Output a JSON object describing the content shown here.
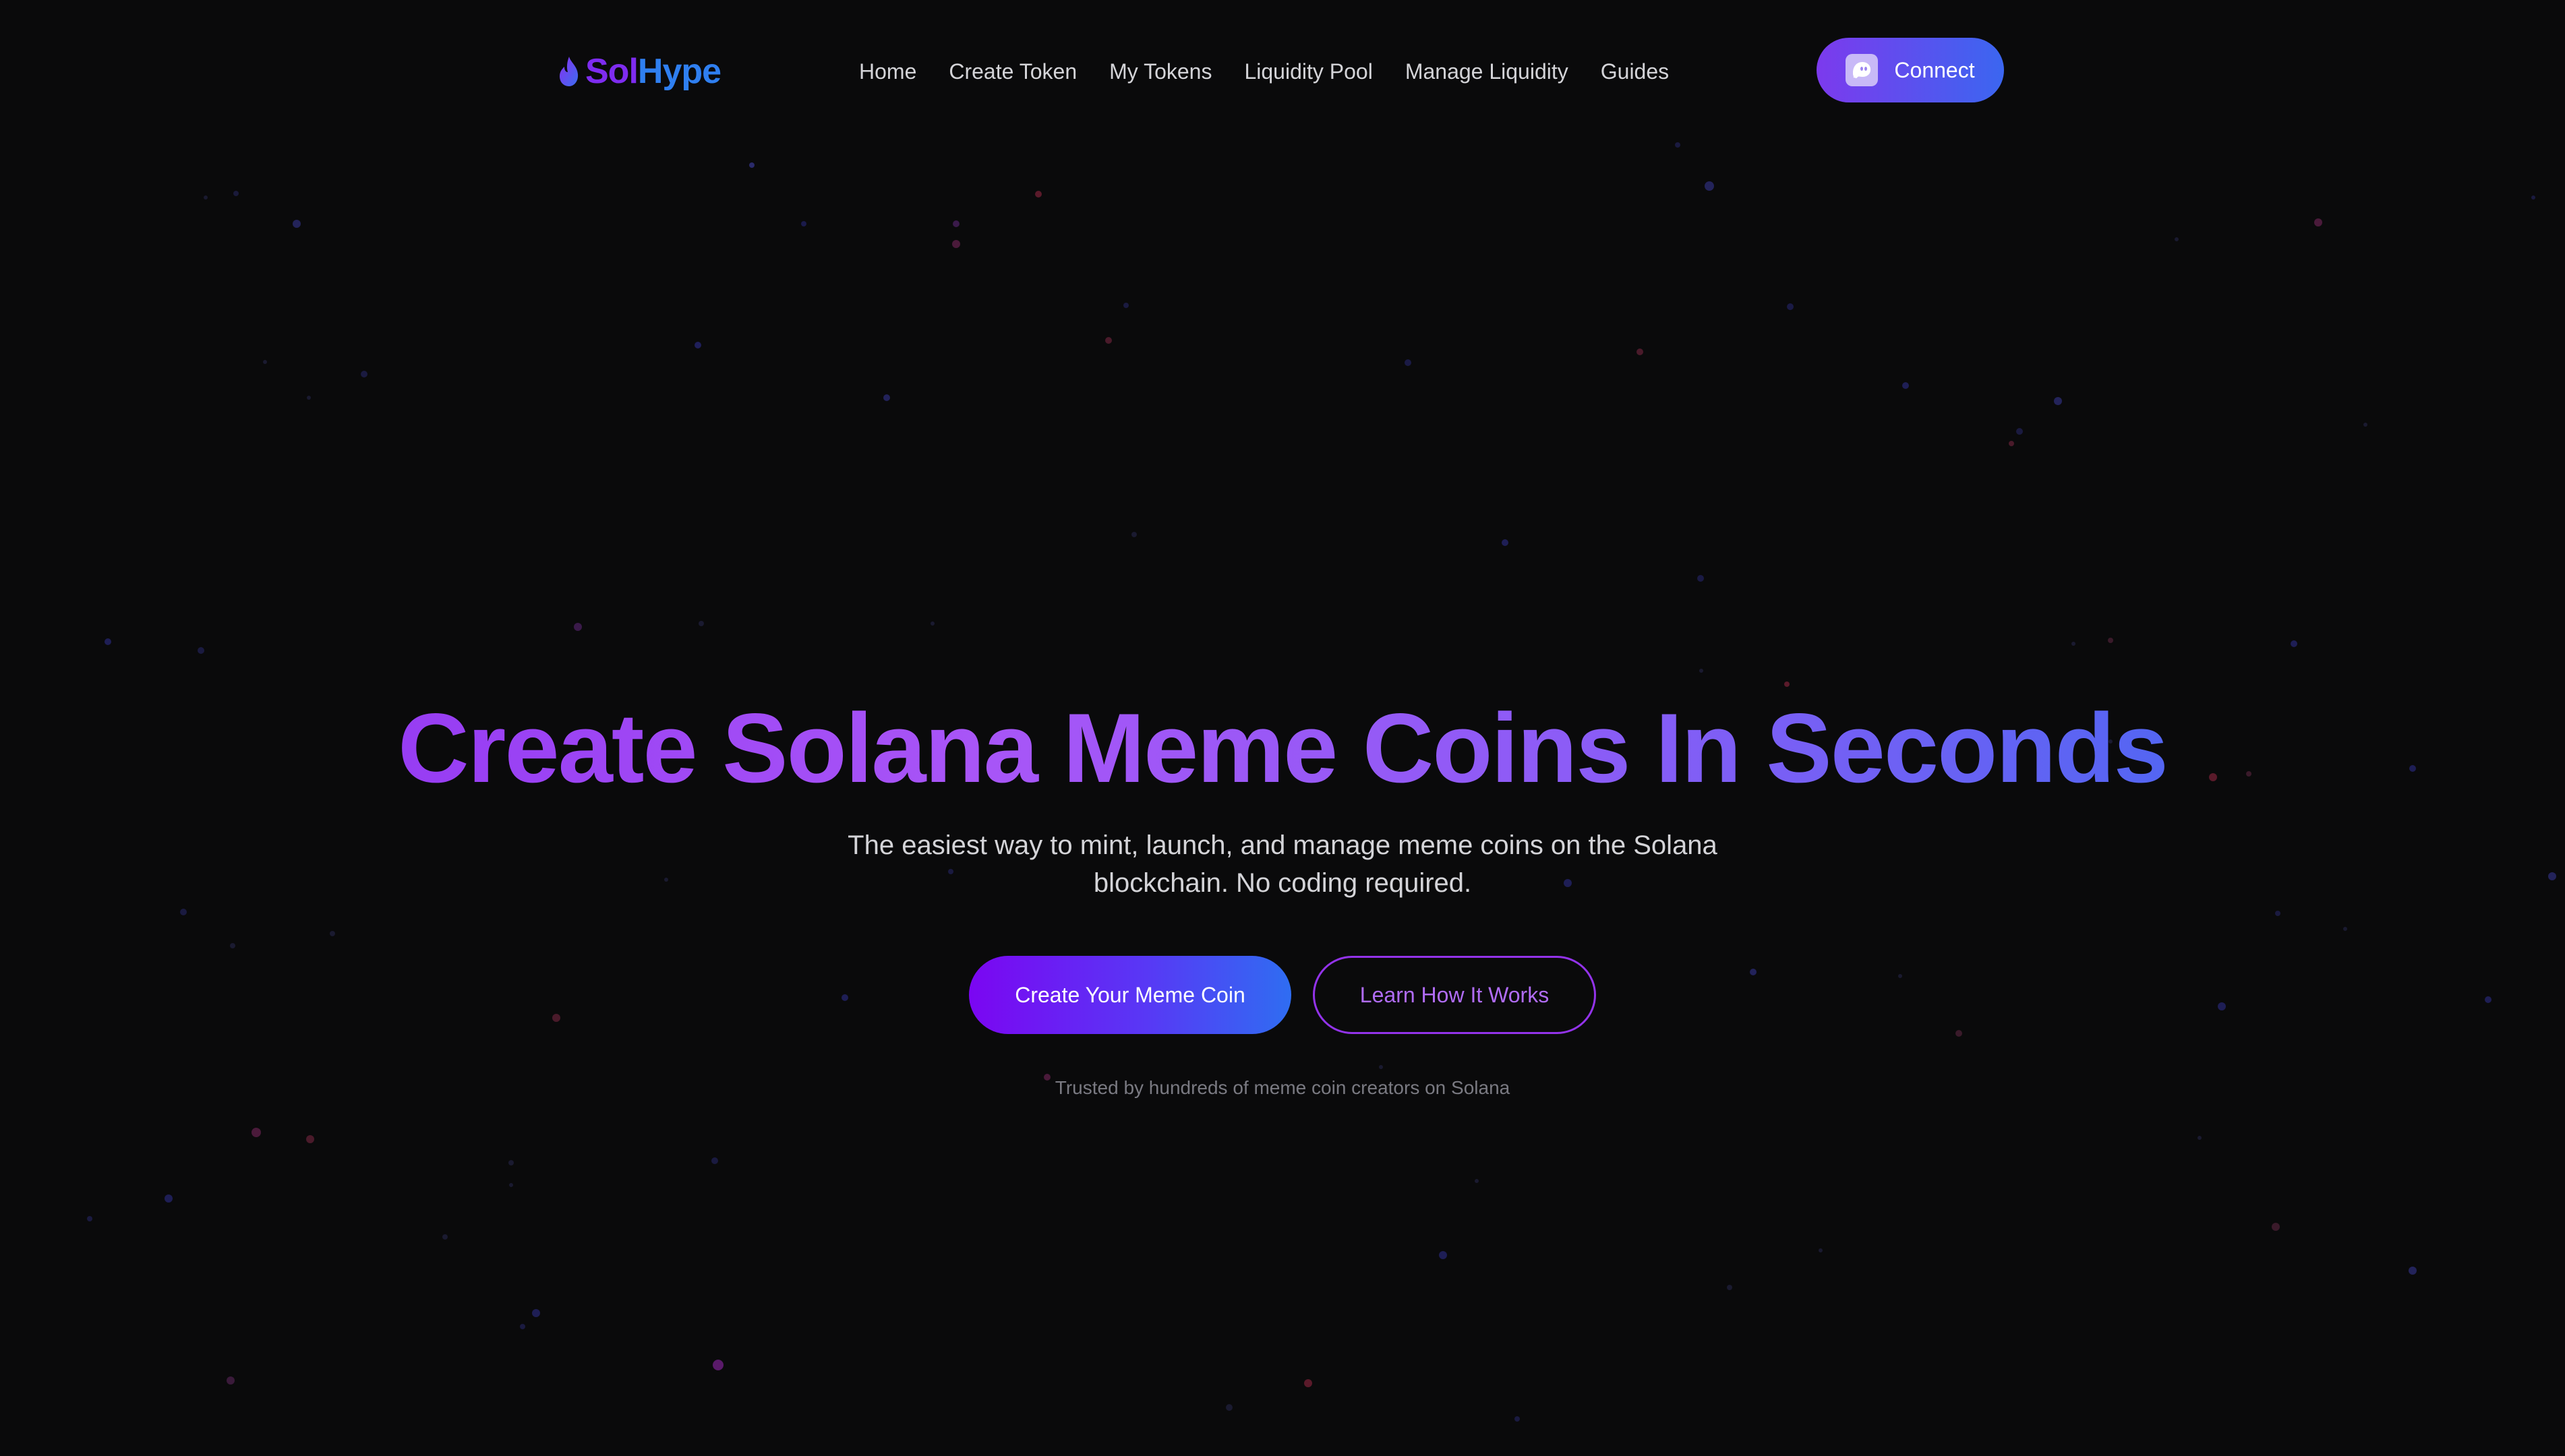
{
  "brand": {
    "name_part1": "Sol",
    "name_part2": "Hype",
    "icon": "flame-icon"
  },
  "nav": {
    "items": [
      {
        "label": "Home"
      },
      {
        "label": "Create Token"
      },
      {
        "label": "My Tokens"
      },
      {
        "label": "Liquidity Pool"
      },
      {
        "label": "Manage Liquidity"
      },
      {
        "label": "Guides"
      }
    ],
    "connect": {
      "label": "Connect",
      "icon": "phantom-ghost-icon"
    }
  },
  "hero": {
    "title": "Create Solana Meme Coins In Seconds",
    "subtitle": "The easiest way to mint, launch, and manage meme coins on the Solana blockchain. No coding required.",
    "primary_cta": "Create Your Meme Coin",
    "secondary_cta": "Learn How It Works",
    "trust_note": "Trusted by hundreds of meme coin creators on Solana"
  },
  "colors": {
    "background": "#0a0a0b",
    "accent_purple": "#7c3aed",
    "accent_blue": "#3b66f0",
    "nav_text": "#d4d4d8",
    "muted_text": "#7a7a82"
  }
}
